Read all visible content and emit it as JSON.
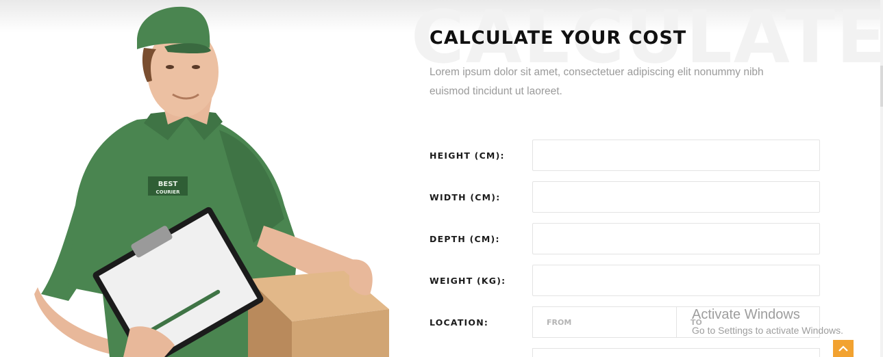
{
  "section": {
    "watermark": "CALCULATE",
    "title": "CALCULATE YOUR COST",
    "description": "Lorem ipsum dolor sit amet, consectetuer adipiscing elit nonummy nibh euismod tincidunt ut laoreet."
  },
  "form": {
    "height_label": "HEIGHT (CM):",
    "width_label": "WIDTH (CM):",
    "depth_label": "DEPTH (CM):",
    "weight_label": "WEIGHT (KG):",
    "location_label": "LOCATION:",
    "height_value": "",
    "width_value": "",
    "depth_value": "",
    "weight_value": "",
    "location_from_placeholder": "FROM",
    "location_to_placeholder": "TO"
  },
  "figure": {
    "shirt_logo_line1": "BEST",
    "shirt_logo_line2": "COURIER",
    "shirt_color": "#4a8550",
    "box_color": "#d1a574"
  },
  "activation": {
    "title": "Activate Windows",
    "subtitle": "Go to Settings to activate Windows."
  },
  "scroll_top": {
    "icon": "chevron-up-icon",
    "color": "#f2a230"
  }
}
